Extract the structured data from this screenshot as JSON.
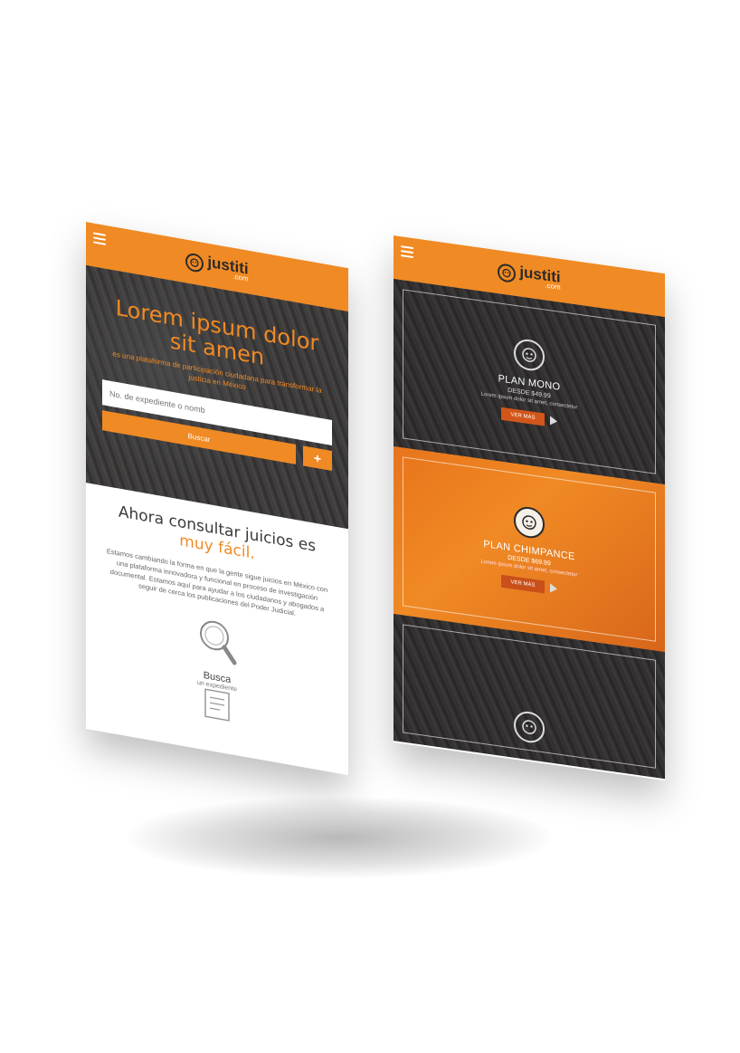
{
  "left_screen": {
    "logo": {
      "name": "justiti",
      "suffix": ".com"
    },
    "hero": {
      "title": "Lorem ipsum dolor sit amen",
      "subtitle": "es una plataforma de participación ciudadana para transformar la justicia en México",
      "search_placeholder": "No. de expediente o nomb",
      "search_button": "Buscar",
      "add_button": "+"
    },
    "section": {
      "title_main": "Ahora consultar juicios es",
      "title_accent": "muy fácil.",
      "body": "Estamos cambiando la forma en que la gente sigue juicios en México con una plataforma innovadora y funcional en proceso de investigación documental. Estamos aquí para ayudar a los ciudadanos y abogados a seguir de cerca los publicaciones del Poder Judicial."
    },
    "feature": {
      "title": "Busca",
      "subtitle": "un expediente"
    }
  },
  "right_screen": {
    "logo": {
      "name": "justiti",
      "suffix": ".com"
    },
    "plans": [
      {
        "name": "PLAN MONO",
        "price": "DESDE $49.99",
        "desc": "Lorem ipsum dolor sit amet, consectetur",
        "button": "VER MÁS"
      },
      {
        "name": "PLAN CHIMPANCE",
        "price": "DESDE $69.99",
        "desc": "Lorem ipsum dolor sit amet, consectetur",
        "button": "VER MÁS"
      }
    ]
  },
  "colors": {
    "accent": "#f08a24",
    "dark": "#3d3a3a"
  },
  "icons": [
    "menu-icon",
    "monkey-logo-icon",
    "magnifier-icon",
    "document-icon",
    "monkey-icon",
    "play-icon"
  ]
}
